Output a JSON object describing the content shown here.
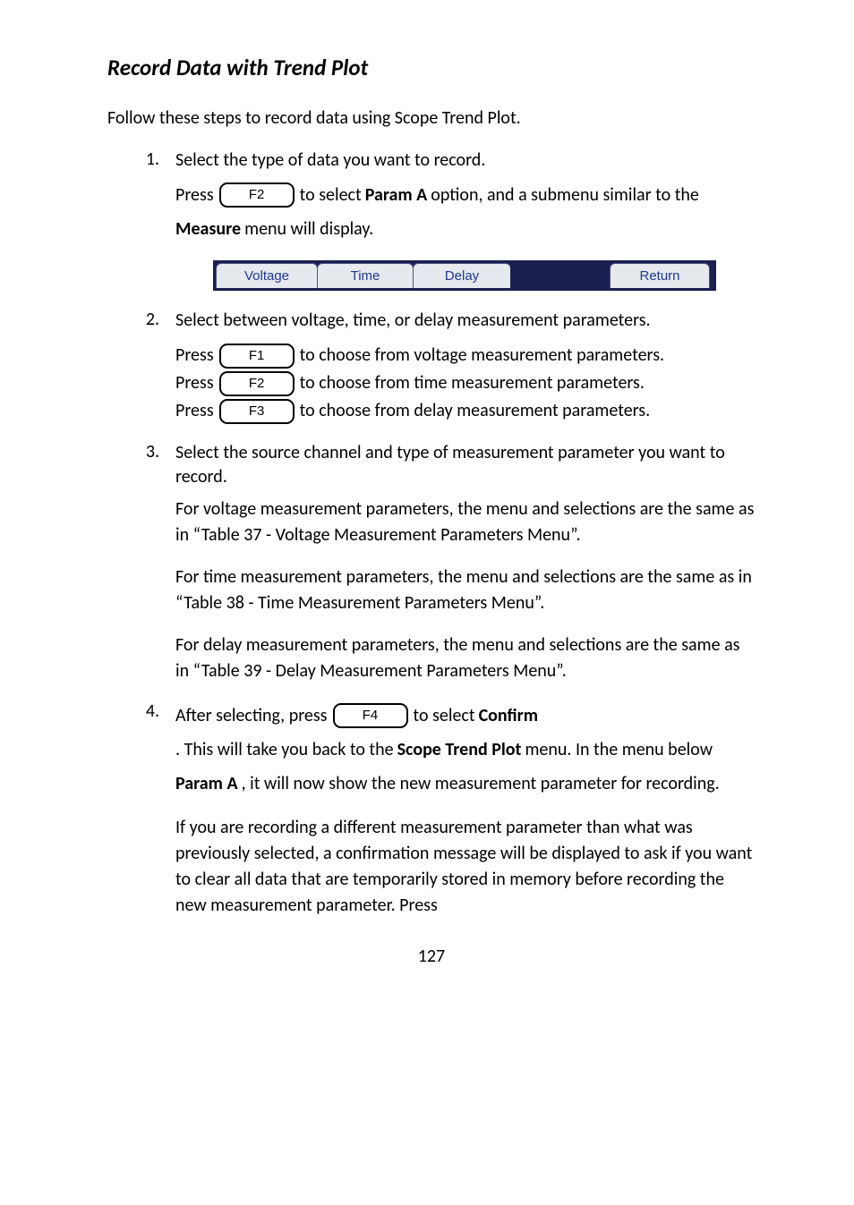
{
  "heading": "Record Data with Trend Plot",
  "intro": "Follow these steps to record data using Scope Trend Plot.",
  "step1_num": "1.",
  "step1_body": "Select the type of data you want to record.",
  "step1_press": "Press ",
  "keys": {
    "F1": "F1",
    "F2": "F2",
    "F3": "F3",
    "F4": "F4"
  },
  "step1_after_key_a": " to select ",
  "step1_param_a": "Param A",
  "step1_after_key_b": " option, and a submenu similar to the ",
  "step1_measure": "Measure",
  "step1_after_measure": " menu will display.",
  "tabs": {
    "voltage": "Voltage",
    "time": "Time",
    "delay": "Delay",
    "return": "Return"
  },
  "step2_num": "2.",
  "step2_body": "Select between voltage, time, or delay measurement parameters.",
  "step2_line1_pre": "Press ",
  "step2_line1_post": " to choose from voltage measurement parameters.",
  "step2_line2_pre": "Press ",
  "step2_line2_post": " to choose from time measurement parameters.",
  "step2_line3_pre": "Press ",
  "step2_line3_post": " to choose from delay measurement parameters.",
  "step3_num": "3.",
  "step3_body": "Select the source channel and type of measurement parameter you want to record.",
  "step3_p1": "For voltage measurement parameters, the menu and selections are the same as in “Table 37 - Voltage Measurement Parameters Menu”.",
  "step3_p2": "For time measurement parameters, the menu and selections are the same as in “Table 38 - Time Measurement Parameters Menu”.",
  "step3_p3": "For delay measurement parameters, the menu and selections are the same as in “Table 39 - Delay Measurement Parameters Menu”.",
  "step4_num": "4.",
  "step4_pre": "After selecting, press ",
  "step4_mid_a": " to select ",
  "step4_confirm": "Confirm",
  "step4_mid_b": ".  This will take you back to the ",
  "step4_stp": "Scope Trend Plot",
  "step4_mid_c": " menu.  In the menu below ",
  "step4_param_a": "Param A",
  "step4_mid_d": ", it will now show the new measurement parameter for recording.",
  "step4_p2": "If you are recording a different measurement parameter than what was previously selected, a confirmation message will be displayed to ask if you want to clear all data that are temporarily stored in memory before recording the new measurement parameter.  Press",
  "page_no": "127"
}
